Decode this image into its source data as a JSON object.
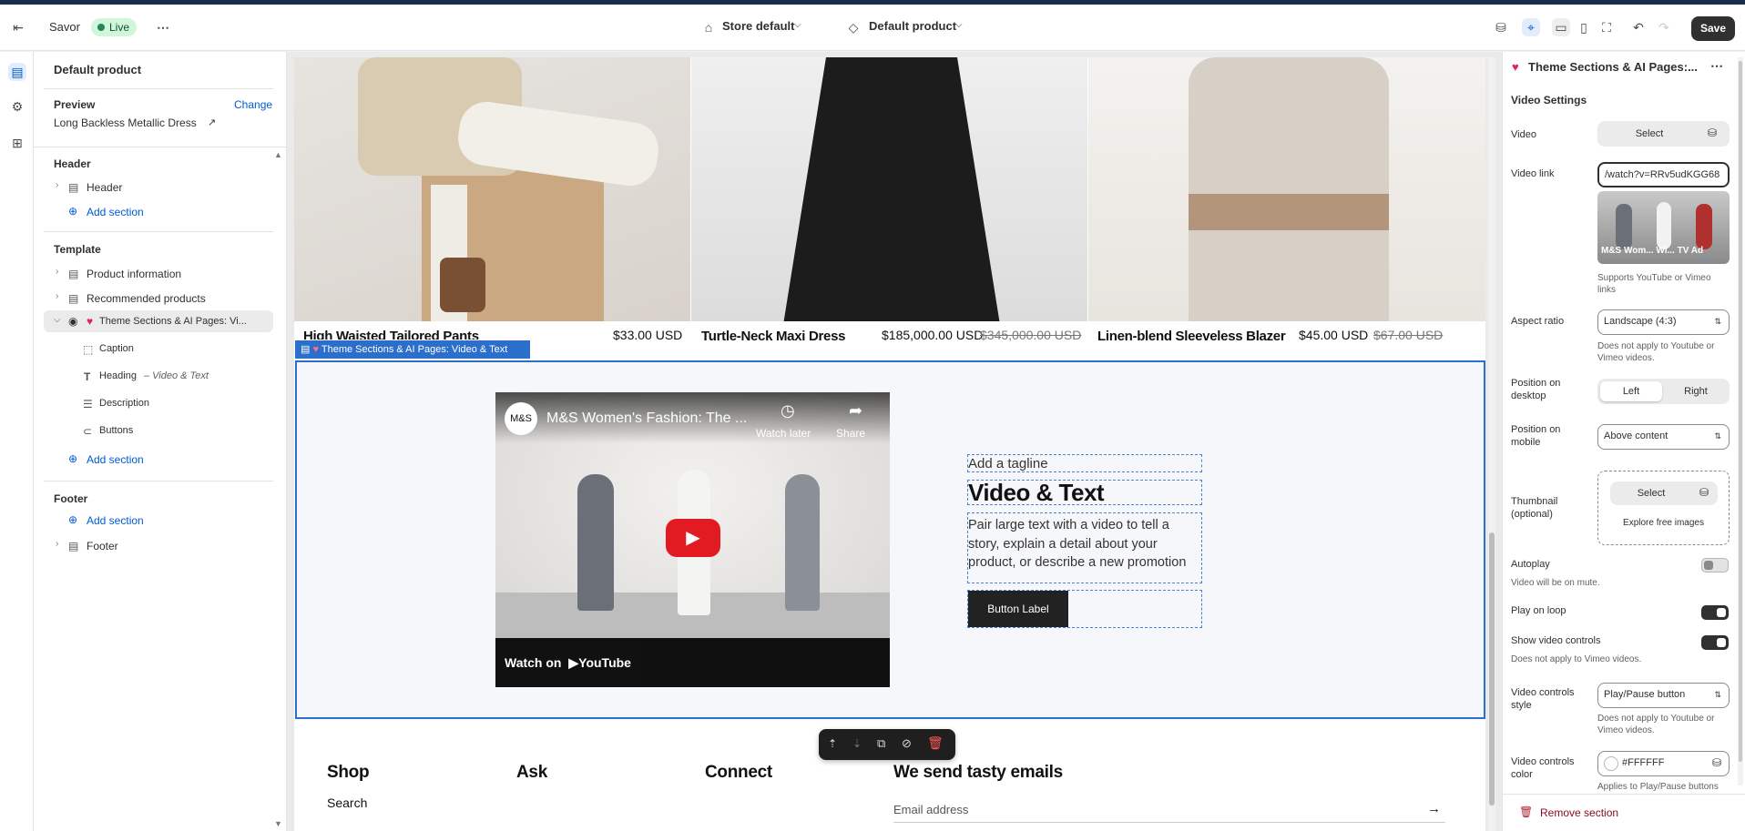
{
  "topbar": {
    "app_name": "Savor",
    "status": "Live",
    "store": "Store default",
    "template": "Default product",
    "save": "Save"
  },
  "left": {
    "title": "Default product",
    "preview_label": "Preview",
    "change": "Change",
    "preview_product": "Long Backless Metallic Dress",
    "header_group": "Header",
    "header_item": "Header",
    "add_section": "Add section",
    "template_group": "Template",
    "template_items": [
      "Product information",
      "Recommended products",
      "Theme Sections & AI Pages: Vi..."
    ],
    "blocks": [
      "Caption",
      "Heading",
      "Description",
      "Buttons"
    ],
    "heading_suffix": "– Video & Text",
    "footer_group": "Footer",
    "footer_item": "Footer"
  },
  "canvas": {
    "products": [
      {
        "name": "High Waisted Tailored Pants",
        "price": "$33.00 USD",
        "compare": ""
      },
      {
        "name": "Turtle-Neck Maxi Dress",
        "price": "$185,000.00 USD",
        "compare": "$345,000.00 USD"
      },
      {
        "name": "Linen-blend Sleeveless Blazer",
        "price": "$45.00 USD",
        "compare": "$67.00 USD"
      }
    ],
    "section_tag": "Theme Sections & AI Pages: Video & Text",
    "video": {
      "channel": "M&S",
      "title": "M&S Women's Fashion: The ...",
      "watch_later": "Watch later",
      "share": "Share",
      "watch_on": "Watch on",
      "youtube": "YouTube"
    },
    "tagline": "Add a tagline",
    "heading": "Video & Text",
    "description": "Pair large text with a video to tell a story, explain a detail about your product, or describe a new promotion",
    "button": "Button Label",
    "footer": {
      "col1": "Shop",
      "col1_link": "Search",
      "col2": "Ask",
      "col3": "Connect",
      "col4": "We send tasty emails",
      "email_placeholder": "Email address"
    }
  },
  "right": {
    "title": "Theme Sections & AI Pages:...",
    "section_heading": "Video Settings",
    "video_label": "Video",
    "select": "Select",
    "video_link_label": "Video link",
    "video_link_value": "/watch?v=RRv5udKGG68",
    "video_thumb_caption": "M&S Wom... Wi... TV Ad",
    "video_link_help": "Supports YouTube or Vimeo links",
    "aspect_label": "Aspect ratio",
    "aspect_value": "Landscape (4:3)",
    "aspect_help": "Does not apply to Youtube or Vimeo videos.",
    "pos_desktop_label": "Position on desktop",
    "left": "Left",
    "right": "Right",
    "pos_mobile_label": "Position on mobile",
    "pos_mobile_value": "Above content",
    "thumb_label": "Thumbnail (optional)",
    "explore": "Explore free images",
    "autoplay_label": "Autoplay",
    "autoplay_help": "Video will be on mute.",
    "loop_label": "Play on loop",
    "controls_label": "Show video controls",
    "controls_help": "Does not apply to Vimeo videos.",
    "style_label": "Video controls style",
    "style_value": "Play/Pause button",
    "style_help": "Does not apply to Youtube or Vimeo videos.",
    "color_label": "Video controls color",
    "color_value": "#FFFFFF",
    "color_help": "Applies to Play/Pause buttons",
    "remove": "Remove section"
  }
}
